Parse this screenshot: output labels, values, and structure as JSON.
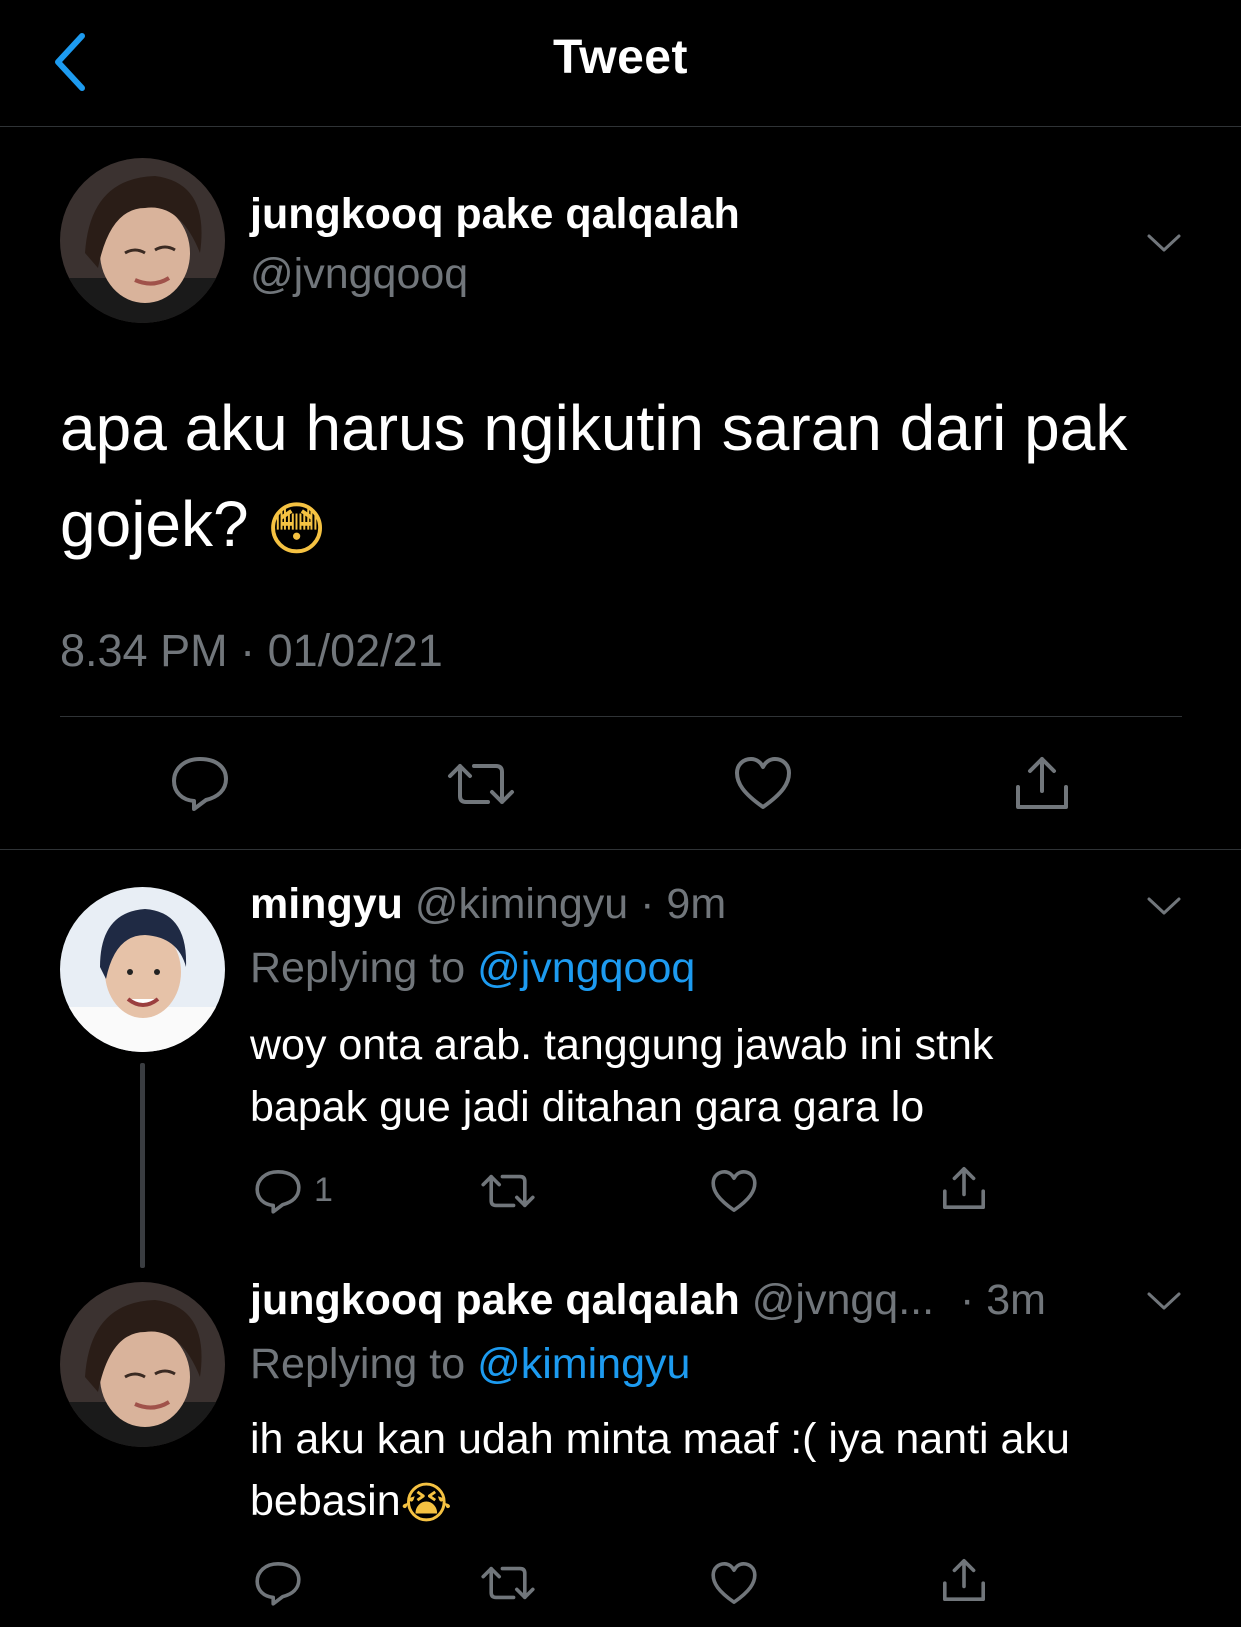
{
  "header": {
    "title": "Tweet"
  },
  "main_tweet": {
    "display_name": "jungkooq pake qalqalah",
    "handle": "@jvngqooq",
    "text": "apa aku harus ngikutin saran dari pak gojek?",
    "emoji": "😳",
    "timestamp": "8.34 PM · 01/02/21"
  },
  "replies": [
    {
      "display_name": "mingyu",
      "handle": "@kimingyu",
      "time": "· 9m",
      "replying_label": "Replying to",
      "replying_to": "@jvngqooq",
      "text_line1": "woy onta arab. tanggung jawab ini stnk",
      "text_line2": "bapak gue jadi ditahan gara gara lo",
      "reply_count": "1"
    },
    {
      "display_name": "jungkooq pake qalqalah",
      "handle": "@jvngq...",
      "time": "· 3m",
      "replying_label": "Replying to",
      "replying_to": "@kimingyu",
      "text_line1": "ih aku kan udah minta maaf :( iya nanti aku",
      "text_line2": "bebasin",
      "emoji": "😭"
    }
  ],
  "colors": {
    "accent": "#1d9bf0",
    "muted": "#71767b",
    "divider": "#2f3336",
    "background": "#000000"
  },
  "icons": [
    "back-chevron-icon",
    "chevron-down-icon",
    "reply-icon",
    "retweet-icon",
    "like-icon",
    "share-icon"
  ]
}
